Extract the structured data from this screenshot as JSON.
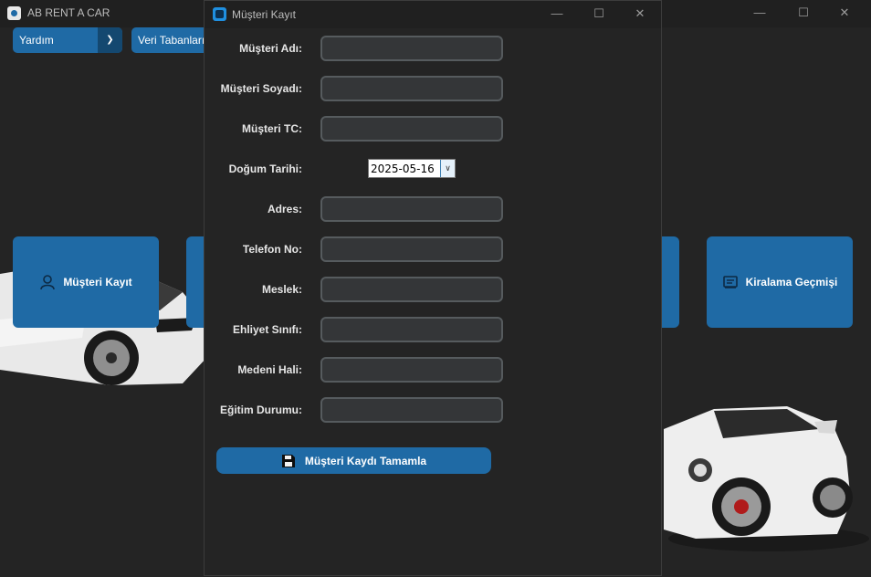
{
  "main_window": {
    "title": "AB RENT A CAR",
    "menu": {
      "help_dropdown": "Yardım",
      "db_dropdown": "Veri Tabanları"
    },
    "buttons": {
      "customer_register": "Müşteri Kayıt",
      "rental_history": "Kiralama Geçmişi"
    }
  },
  "dialog": {
    "title": "Müşteri Kayıt",
    "fields": [
      {
        "label": "Müşteri Adı:",
        "value": ""
      },
      {
        "label": "Müşteri Soyadı:",
        "value": ""
      },
      {
        "label": "Müşteri TC:",
        "value": ""
      },
      {
        "label": "Doğum Tarihi:",
        "value": "2025-05-16"
      },
      {
        "label": "Adres:",
        "value": ""
      },
      {
        "label": "Telefon No:",
        "value": ""
      },
      {
        "label": "Meslek:",
        "value": ""
      },
      {
        "label": "Ehliyet Sınıfı:",
        "value": ""
      },
      {
        "label": "Medeni Hali:",
        "value": ""
      },
      {
        "label": "Eğitim Durumu:",
        "value": ""
      }
    ],
    "submit_label": "Müşteri Kaydı Tamamla"
  }
}
